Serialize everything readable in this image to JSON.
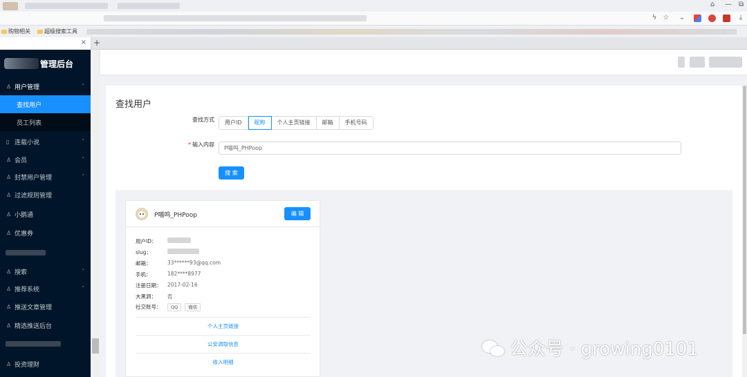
{
  "browser": {
    "bookmarks": [
      "购物相关",
      "超级搜索工具"
    ],
    "new_tab": "+",
    "tab_close": "×",
    "window_controls": [
      "minimize-icon",
      "restore-icon"
    ]
  },
  "sidebar": {
    "brand_suffix": "管理后台",
    "menu": [
      {
        "label": "用户管理",
        "icon": "user-icon",
        "expanded": true
      },
      {
        "label": "查找用户",
        "sub": true,
        "active": true
      },
      {
        "label": "员工列表",
        "sub": true
      },
      {
        "label": "连载小说",
        "icon": "book-icon",
        "arrow": true
      },
      {
        "label": "会员",
        "icon": "user-icon",
        "arrow": true
      },
      {
        "label": "封禁用户管理",
        "icon": "user-icon",
        "arrow": true
      },
      {
        "label": "过滤规则管理",
        "icon": "user-icon"
      },
      {
        "label": "小鹅通",
        "icon": "user-icon"
      },
      {
        "label": "优惠券",
        "icon": "user-icon"
      },
      {
        "label": "搜索",
        "icon": "user-icon",
        "arrow": true
      },
      {
        "label": "推荐系统",
        "icon": "user-icon",
        "arrow": true
      },
      {
        "label": "推送文章管理",
        "icon": "user-icon"
      },
      {
        "label": "精选推送后台",
        "icon": "user-icon"
      },
      {
        "label": "投资理财",
        "icon": "user-icon"
      }
    ]
  },
  "page": {
    "title": "查找用户",
    "search_method_label": "查找方式",
    "search_methods": [
      "用户ID",
      "昵称",
      "个人主页链接",
      "邮箱",
      "手机号码"
    ],
    "active_method": "昵称",
    "input_label": "输入内容",
    "input_value": "P喵呜_PHPoop",
    "search_button": "搜 索"
  },
  "user_card": {
    "name": "P喵呜_PHPoop",
    "edit_button": "编 辑",
    "fields": [
      {
        "key": "用户ID：",
        "value": ""
      },
      {
        "key": "slug：",
        "value": ""
      },
      {
        "key": "邮箱：",
        "value": "33******93@qq.com"
      },
      {
        "key": "手机：",
        "value": "182****8977"
      },
      {
        "key": "注册日期：",
        "value": "2017-02-16"
      },
      {
        "key": "大黑洞：",
        "value": "否"
      }
    ],
    "social_label": "社交账号：",
    "social_tags": [
      "QQ",
      "微信"
    ],
    "links": [
      "个人主页链接",
      "公安调取信息",
      "收入明细"
    ]
  },
  "watermark": {
    "text": "公众号 · growing0101"
  },
  "colors": {
    "primary": "#1890ff",
    "sidebar_bg": "#001529",
    "danger": "#f5222d"
  }
}
